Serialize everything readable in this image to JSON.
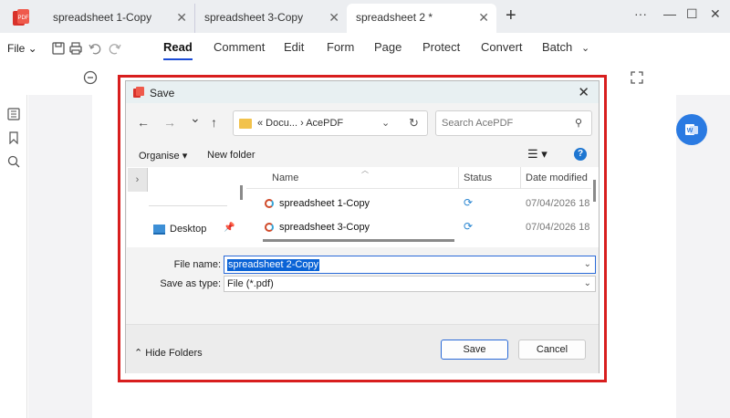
{
  "app": {
    "tabs": [
      {
        "label": "spreadsheet 1-Copy",
        "close": "✕"
      },
      {
        "label": "spreadsheet 3-Copy",
        "close": "✕"
      },
      {
        "label": "spreadsheet 2 *",
        "close": "✕"
      }
    ],
    "add_tab": "+",
    "window_controls": {
      "more": "···",
      "minimize": "—",
      "maximize": "☐",
      "close": "✕"
    }
  },
  "toolbar": {
    "file": "File",
    "menus": [
      "Read",
      "Comment",
      "Edit",
      "Form",
      "Page",
      "Protect",
      "Convert",
      "Batch"
    ],
    "active_menu": "Read"
  },
  "dialog": {
    "title": "Save",
    "close": "✕",
    "nav": {
      "back": "←",
      "forward": "→",
      "down": "⌄",
      "up": "↑"
    },
    "address_path": "«  Docu...  ›  AcePDF",
    "search_placeholder": "Search AcePDF",
    "organise": "Organise ▾",
    "new_folder": "New folder",
    "view": "☰ ▾",
    "help": "?",
    "nav_pane": {
      "expand": "›",
      "items": [
        {
          "label": "Desktop",
          "pin": "📌"
        }
      ]
    },
    "columns": [
      "Name",
      "Status",
      "Date modified"
    ],
    "files": [
      {
        "name": "spreadsheet 1-Copy",
        "status": "⟳",
        "date": "07/04/2026 18"
      },
      {
        "name": "spreadsheet 3-Copy",
        "status": "⟳",
        "date": "07/04/2026 18"
      }
    ],
    "file_name_label": "File name:",
    "file_name_value": "spreadsheet 2-Copy",
    "save_as_type_label": "Save as type:",
    "save_as_type_value": "File (*.pdf)",
    "hide_folders": "Hide Folders",
    "save_button": "Save",
    "cancel_button": "Cancel"
  },
  "colors": {
    "accent": "#1a4bd6",
    "highlight": "#d81e1e",
    "brand_red": "#d8322b"
  }
}
